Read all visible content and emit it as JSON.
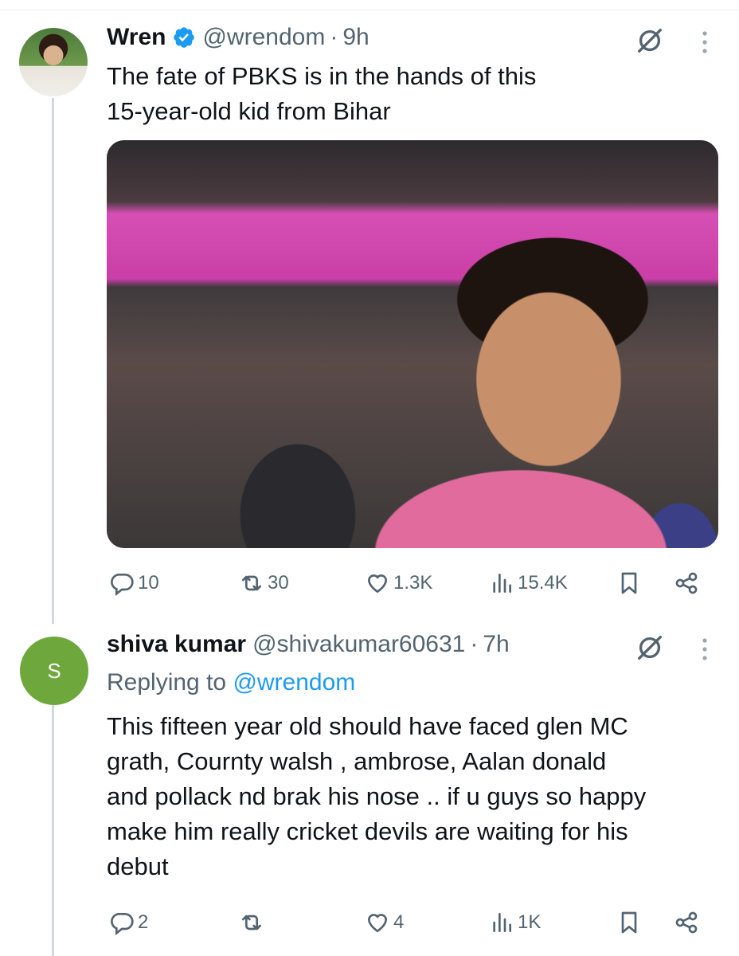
{
  "tweet": {
    "author": {
      "name": "Wren",
      "handle": "@wrendom",
      "verified": true
    },
    "time": "9h",
    "text_lines": [
      "The fate of PBKS is in the hands of this",
      "15-year-old kid from Bihar"
    ],
    "metrics": {
      "replies": "10",
      "reposts": "30",
      "likes": "1.3K",
      "views": "15.4K"
    }
  },
  "reply": {
    "author": {
      "name": "shiva kumar",
      "handle": "@shivakumar60631",
      "avatar_letter": "S"
    },
    "time": "7h",
    "replying_prefix": "Replying to",
    "replying_to": "@wrendom",
    "text_lines": [
      "This fifteen year old should have faced glen MC",
      "grath, Cournty walsh , ambrose, Aalan donald",
      "and pollack nd brak his nose ..  if u guys so happy",
      "make him really cricket  devils are waiting for his",
      "debut"
    ],
    "metrics": {
      "replies": "2",
      "reposts": "",
      "likes": "4",
      "views": "1K"
    }
  },
  "separator": "·",
  "colors": {
    "accent": "#1d9bf0",
    "muted": "#536471",
    "avatar_bg": "#6ea83c"
  },
  "icons": [
    "verified-badge-icon",
    "grok-icon",
    "more-icon",
    "reply-icon",
    "repost-icon",
    "like-icon",
    "views-icon",
    "bookmark-icon",
    "share-icon"
  ]
}
